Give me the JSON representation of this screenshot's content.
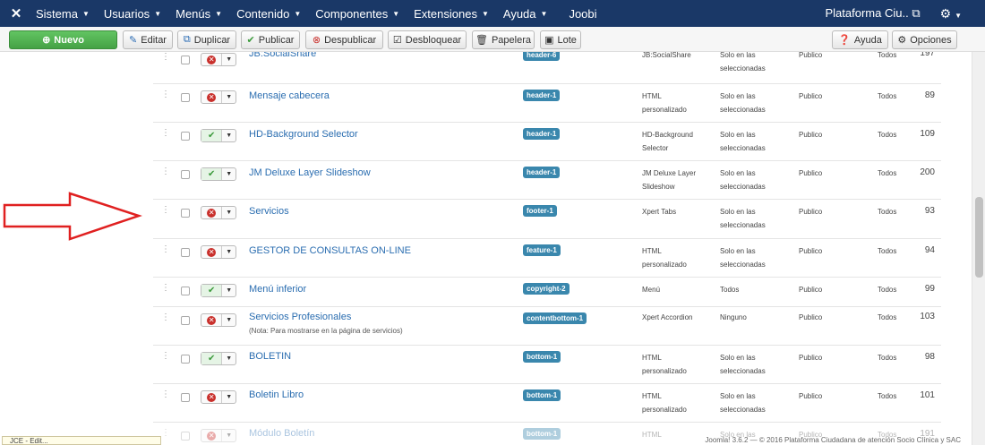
{
  "nav": {
    "logo_icon": "joomla-logo-icon",
    "items": [
      {
        "label": "Sistema"
      },
      {
        "label": "Usuarios"
      },
      {
        "label": "Menús"
      },
      {
        "label": "Contenido"
      },
      {
        "label": "Componentes"
      },
      {
        "label": "Extensiones"
      },
      {
        "label": "Ayuda"
      },
      {
        "label": "Joobi"
      }
    ],
    "site_name": "Plataforma Ciu..",
    "site_icon": "external-link-icon",
    "settings_icon": "gear-icon"
  },
  "toolbar": {
    "new": "Nuevo",
    "edit": "Editar",
    "duplicate": "Duplicar",
    "publish": "Publicar",
    "unpublish": "Despublicar",
    "unlock": "Desbloquear",
    "trash": "Papelera",
    "batch": "Lote",
    "help": "Ayuda",
    "options": "Opciones"
  },
  "rows": [
    {
      "title": "JB:SocialShare",
      "position": "header-6",
      "type": [
        "JB:SocialShare"
      ],
      "pages": [
        "Solo en las",
        "seleccionadas"
      ],
      "access": "Publico",
      "language": "Todos",
      "id": "197",
      "published": false
    },
    {
      "title": "Mensaje cabecera",
      "position": "header-1",
      "type": [
        "HTML",
        "personalizado"
      ],
      "pages": [
        "Solo en las",
        "seleccionadas"
      ],
      "access": "Publico",
      "language": "Todos",
      "id": "89",
      "published": false
    },
    {
      "title": "HD-Background Selector",
      "position": "header-1",
      "type": [
        "HD-Background",
        "Selector"
      ],
      "pages": [
        "Solo en las",
        "seleccionadas"
      ],
      "access": "Publico",
      "language": "Todos",
      "id": "109",
      "published": true
    },
    {
      "title": "JM Deluxe Layer Slideshow",
      "position": "header-1",
      "type": [
        "JM Deluxe Layer",
        "Slideshow"
      ],
      "pages": [
        "Solo en las",
        "seleccionadas"
      ],
      "access": "Publico",
      "language": "Todos",
      "id": "200",
      "published": true
    },
    {
      "title": "Servicios",
      "position": "footer-1",
      "type": [
        "Xpert Tabs"
      ],
      "pages": [
        "Solo en las",
        "seleccionadas"
      ],
      "access": "Publico",
      "language": "Todos",
      "id": "93",
      "published": false
    },
    {
      "title": "GESTOR DE CONSULTAS ON-LINE",
      "position": "feature-1",
      "type": [
        "HTML",
        "personalizado"
      ],
      "pages": [
        "Solo en las",
        "seleccionadas"
      ],
      "access": "Publico",
      "language": "Todos",
      "id": "94",
      "published": false
    },
    {
      "title": "Menú inferior",
      "position": "copyright-2",
      "type": [
        "Menú"
      ],
      "pages": [
        "Todos"
      ],
      "access": "Publico",
      "language": "Todos",
      "id": "99",
      "published": true
    },
    {
      "title": "Servicios Profesionales",
      "note": "(Nota: Para mostrarse en la página de servicios)",
      "position": "contentbottom-1",
      "type": [
        "Xpert Accordion"
      ],
      "pages": [
        "Ninguno"
      ],
      "access": "Publico",
      "language": "Todos",
      "id": "103",
      "published": false
    },
    {
      "title": "BOLETIN",
      "position": "bottom-1",
      "type": [
        "HTML",
        "personalizado"
      ],
      "pages": [
        "Solo en las",
        "seleccionadas"
      ],
      "access": "Publico",
      "language": "Todos",
      "id": "98",
      "published": true
    },
    {
      "title": "Boletin Libro",
      "position": "bottom-1",
      "type": [
        "HTML",
        "personalizado"
      ],
      "pages": [
        "Solo en las",
        "seleccionadas"
      ],
      "access": "Publico",
      "language": "Todos",
      "id": "101",
      "published": false
    },
    {
      "title": "Módulo Boletín",
      "position": "bottom-1",
      "type": [
        "HTML"
      ],
      "pages": [
        "Solo en las"
      ],
      "access": "Publico",
      "language": "Todos",
      "id": "191",
      "published": false
    }
  ],
  "statusbar": {
    "left": "JCE - Edit...",
    "right": "Joomla! 3.6.2 — © 2016 Plataforma Ciudadana de atención Socio Clínica y SAC"
  },
  "colors": {
    "nav_bg": "#1a3867",
    "link": "#2a6db0",
    "badge": "#3a87ad",
    "arrow": "#e02020"
  }
}
